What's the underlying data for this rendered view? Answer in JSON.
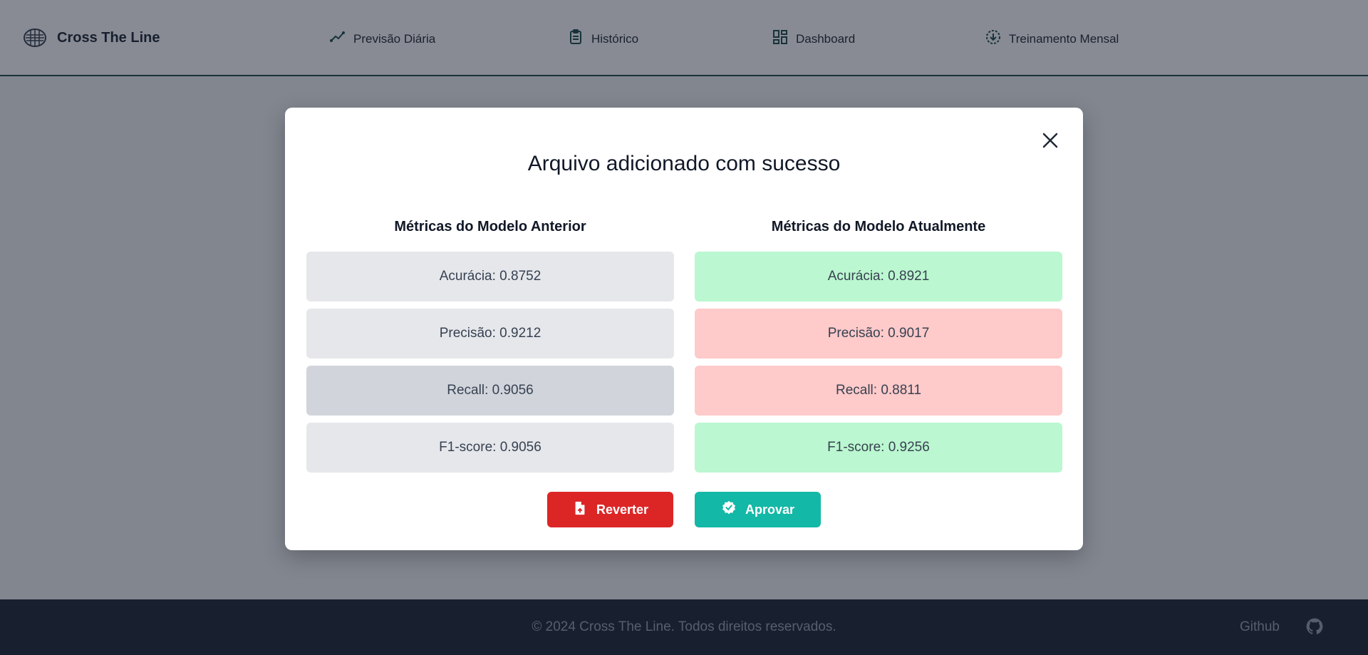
{
  "header": {
    "brand": "Cross The Line",
    "nav": [
      {
        "label": "Previsão Diária",
        "icon": "trend-chart-icon"
      },
      {
        "label": "Histórico",
        "icon": "clipboard-icon"
      },
      {
        "label": "Dashboard",
        "icon": "dashboard-grid-icon"
      },
      {
        "label": "Treinamento Mensal",
        "icon": "download-circle-icon"
      }
    ]
  },
  "modal": {
    "title": "Arquivo adicionado com sucesso",
    "previous": {
      "title": "Métricas do Modelo Anterior",
      "metrics": [
        "Acurácia: 0.8752",
        "Precisão: 0.9212",
        "Recall: 0.9056",
        "F1-score: 0.9056"
      ]
    },
    "current": {
      "title": "Métricas do Modelo Atualmente",
      "metrics": [
        "Acurácia: 0.8921",
        "Precisão: 0.9017",
        "Recall: 0.8811",
        "F1-score: 0.9256"
      ]
    },
    "buttons": {
      "revert": "Reverter",
      "approve": "Aprovar"
    }
  },
  "footer": {
    "copyright": "© 2024 Cross The Line. Todos direitos reservados.",
    "github": "Github"
  },
  "colors": {
    "improved": "#bbf7d0",
    "worse": "#fecaca",
    "neutral": "#e5e7eb",
    "revert": "#dc2626",
    "approve": "#14b8a6",
    "header_border": "#1e4d4f",
    "footer_bg": "#1f2937"
  }
}
